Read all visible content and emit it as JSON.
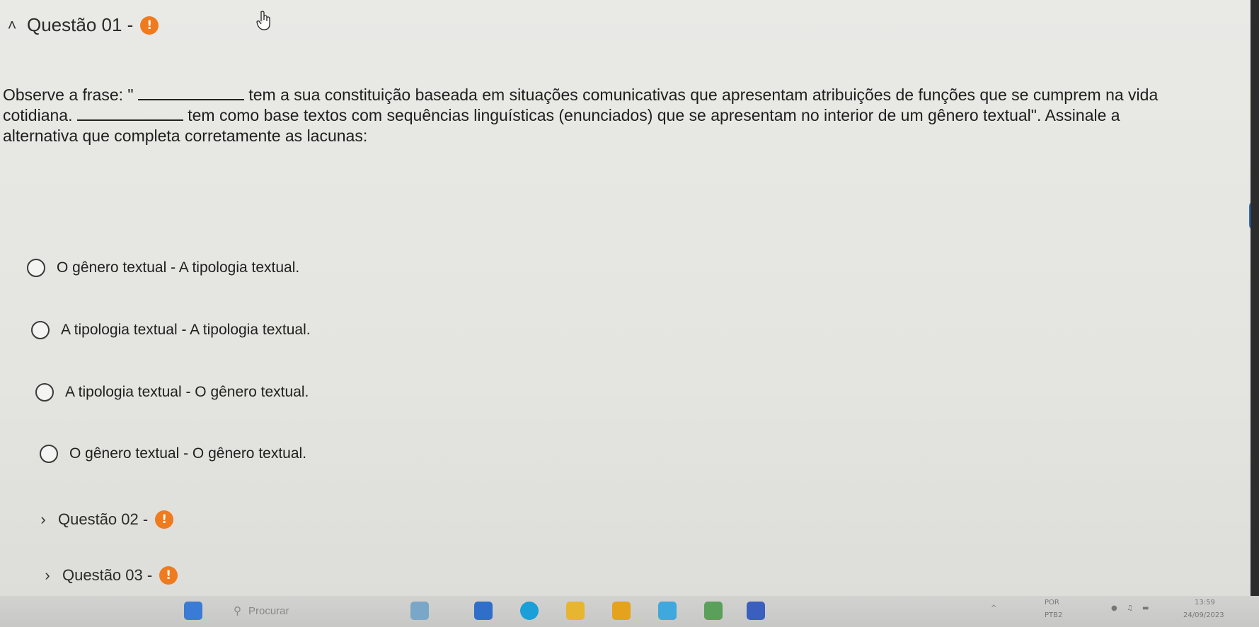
{
  "questions": [
    {
      "label": "Questão 01 -",
      "expanded": true,
      "badge": "!"
    },
    {
      "label": "Questão 02 -",
      "expanded": false,
      "badge": "!"
    },
    {
      "label": "Questão 03 -",
      "expanded": false,
      "badge": "!"
    }
  ],
  "question1": {
    "line1_prefix": "Observe a frase: \"",
    "line1_suffix": "tem a sua constituição baseada em situações comunicativas que apresentam atribuições de funções que se cumprem na vida",
    "line2_prefix": "cotidiana.",
    "line2_suffix": "tem como base textos com sequências linguísticas (enunciados) que se apresentam no interior de um gênero textual\". Assinale a",
    "line3": "alternativa que completa corretamente as lacunas:",
    "options": [
      "O gênero textual - A tipologia textual.",
      "A tipologia textual - A tipologia textual.",
      "A tipologia textual - O gênero textual.",
      "O gênero textual - O gênero textual."
    ]
  },
  "taskbar": {
    "search_placeholder": "Procurar",
    "lang_top": "POR",
    "lang_bottom": "PTB2",
    "time": "13:59",
    "date": "24/09/2023"
  },
  "colors": {
    "badge": "#f07a1e",
    "accent": "#2f6fc9"
  }
}
